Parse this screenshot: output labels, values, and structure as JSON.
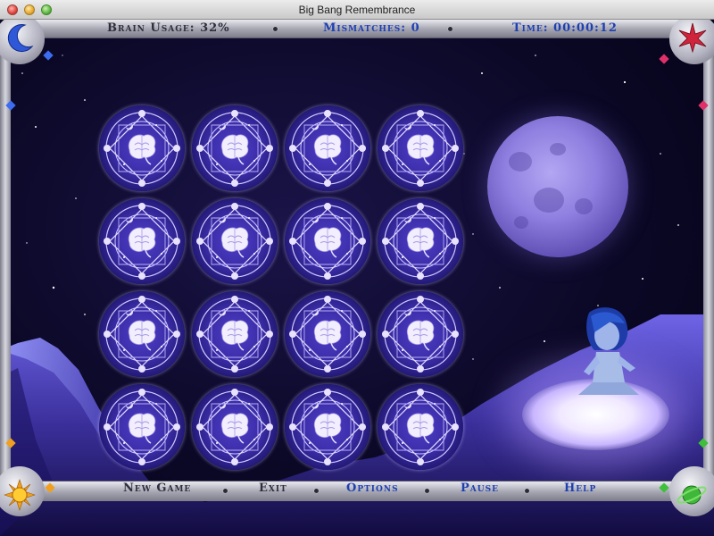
{
  "window": {
    "title": "Big Bang Remembrance"
  },
  "hud": {
    "brain_usage": "Brain Usage: 32%",
    "mismatches": "Mismatches: 0",
    "time": "Time: 00:00:12"
  },
  "menu": {
    "new_game": "New Game",
    "exit": "Exit",
    "options": "Options",
    "pause": "Pause",
    "help": "Help"
  },
  "board": {
    "rows": 4,
    "cols": 4,
    "card_face": "brain-emblem",
    "cards_face_down": 16
  },
  "corner_icons": [
    "crescent-moon-icon",
    "star-icon",
    "sun-icon",
    "planet-icon"
  ],
  "colors": {
    "hud_dark": "#2d2d3c",
    "hud_blue": "#1e3fb0",
    "card_base": "#3a2ca6"
  }
}
